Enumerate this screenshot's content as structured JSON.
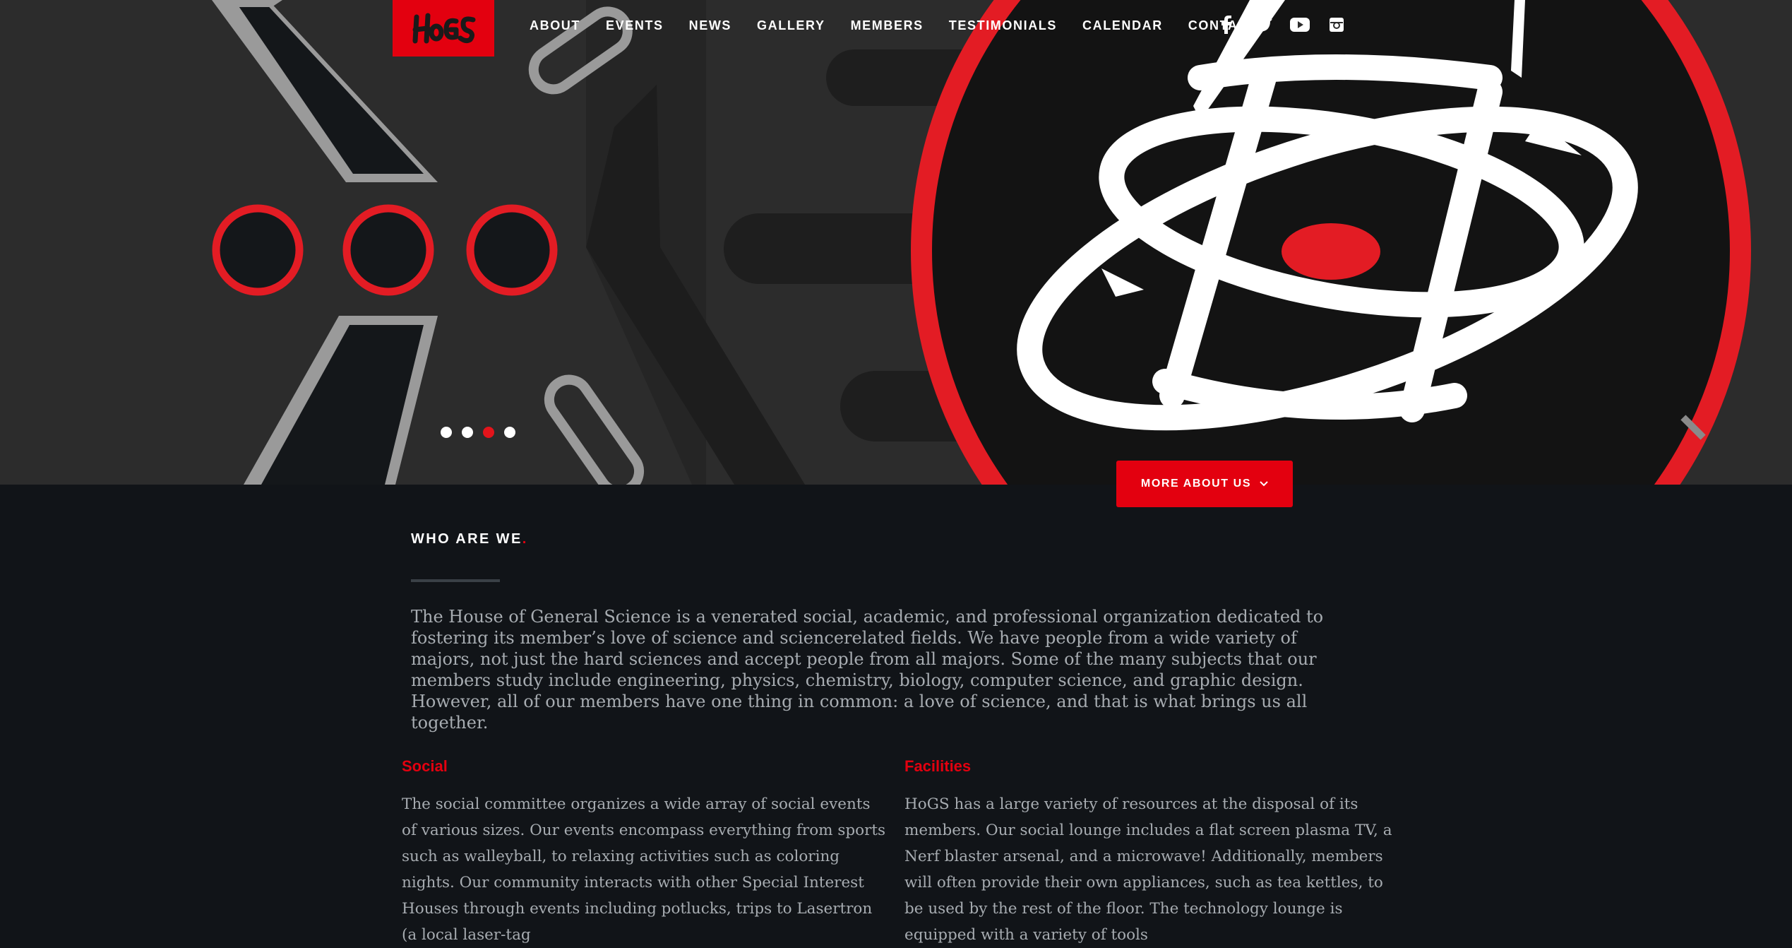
{
  "brand": {
    "logo_text": "HoGS",
    "accent_color": "#e3000f"
  },
  "nav": {
    "items": [
      "ABOUT",
      "EVENTS",
      "NEWS",
      "GALLERY",
      "MEMBERS",
      "TESTIMONIALS",
      "CALENDAR",
      "CONTACT"
    ]
  },
  "social": [
    "facebook-icon",
    "twitter-icon",
    "youtube-icon",
    "instagram-icon"
  ],
  "slider": {
    "dot_count": 4,
    "active_index": 2
  },
  "more_button": {
    "label": "MORE ABOUT US",
    "icon": "chevron-down-icon"
  },
  "who": {
    "title": "WHO ARE WE",
    "title_dot": ".",
    "paragraph": "The House of General Science is a venerated social, academic, and professional organization dedicated to fostering its member’s love of science and sciencerelated fields. We have people from a wide variety of majors, not just the hard sciences and accept people from all majors. Some of the many subjects that our members study include engineering, physics, chemistry, biology, computer science, and graphic design. However, all of our members have one thing in common: a love of science, and that is what brings us all together."
  },
  "social_section": {
    "title": "Social",
    "text": "The social committee organizes a wide array of social events of various sizes. Our events encompass everything from sports such as walleyball, to relaxing activities such as coloring nights. Our community interacts with other Special Interest Houses through events including potlucks, trips to Lasertron (a local laser-tag"
  },
  "facilities_section": {
    "title": "Facilities",
    "text": "HoGS has a large variety of resources at the disposal of its members. Our social lounge includes a flat screen plasma TV, a Nerf blaster arsenal, and a microwave! Additionally, members will often provide their own appliances, such as tea kettles, to be used by the rest of the floor. The technology lounge is equipped with a variety of tools"
  }
}
